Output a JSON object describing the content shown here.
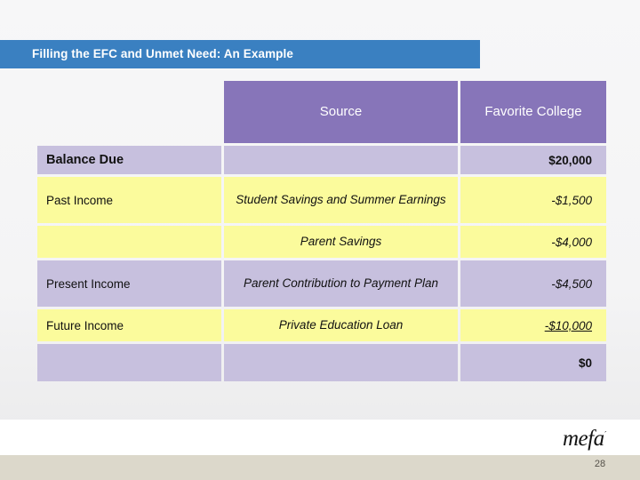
{
  "slide": {
    "title": "Filling the EFC and Unmet Need: An Example",
    "page_number": "28",
    "logo_text": "mefa",
    "logo_mark": "´",
    "colors": {
      "title_bar": "#3a80c1",
      "header_purple": "#8775b9",
      "row_lilac": "#c7c0de",
      "row_yellow": "#fbfb9c",
      "footer_beige": "#dcd8cb",
      "text": "#111111"
    }
  },
  "table": {
    "headers": {
      "label_col": "",
      "source_col": "Source",
      "amount_col": "Favorite College"
    },
    "rows": [
      {
        "label": "Balance Due",
        "source": "",
        "amount": "$20,000"
      },
      {
        "label": "Past Income",
        "source": "Student Savings and Summer Earnings",
        "amount": "-$1,500"
      },
      {
        "label": "",
        "source": "Parent Savings",
        "amount": "-$4,000"
      },
      {
        "label": "Present Income",
        "source": "Parent Contribution to Payment Plan",
        "amount": "-$4,500"
      },
      {
        "label": "Future Income",
        "source": "Private Education Loan",
        "amount": "-$10,000"
      },
      {
        "label": "",
        "source": "",
        "amount": "$0"
      }
    ]
  }
}
